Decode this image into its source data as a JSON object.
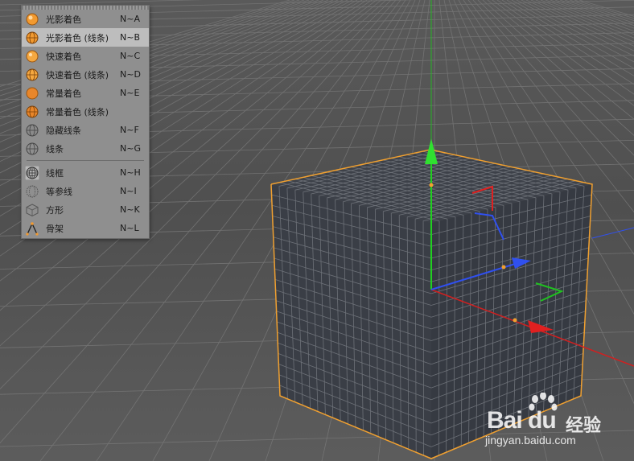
{
  "menu": {
    "items": [
      {
        "label": "光影着色",
        "shortcut": "N~A",
        "icon": "shaded-sphere-icon"
      },
      {
        "label": "光影着色 (线条)",
        "shortcut": "N~B",
        "icon": "shaded-wire-sphere-icon",
        "selected": true
      },
      {
        "label": "快速着色",
        "shortcut": "N~C",
        "icon": "quick-shaded-sphere-icon"
      },
      {
        "label": "快速着色 (线条)",
        "shortcut": "N~D",
        "icon": "quick-shaded-wire-sphere-icon"
      },
      {
        "label": "常量着色",
        "shortcut": "N~E",
        "icon": "constant-shaded-sphere-icon"
      },
      {
        "label": "常量着色 (线条)",
        "shortcut": "",
        "icon": "constant-shaded-wire-sphere-icon"
      },
      {
        "label": "隐藏线条",
        "shortcut": "N~F",
        "icon": "hidden-line-sphere-icon"
      },
      {
        "label": "线条",
        "shortcut": "N~G",
        "icon": "lines-sphere-icon"
      },
      {
        "label": "线框",
        "shortcut": "N~H",
        "icon": "wireframe-sphere-icon"
      },
      {
        "label": "等参线",
        "shortcut": "N~I",
        "icon": "isoparm-sphere-icon"
      },
      {
        "label": "方形",
        "shortcut": "N~K",
        "icon": "box-icon"
      },
      {
        "label": "骨架",
        "shortcut": "N~L",
        "icon": "skeleton-icon"
      }
    ]
  },
  "watermark": {
    "brand": "Bai du",
    "cn": "经验",
    "url": "jingyan.baidu.com"
  },
  "colors": {
    "menu_bg": "#8f8f8f",
    "selected_bg": "#bdbdbd",
    "cube_face": "#3a3e46",
    "cube_outline": "#f0a030",
    "axis_x": "#e02020",
    "axis_y": "#20c020",
    "axis_z": "#2040e0",
    "floor": "#505050"
  }
}
